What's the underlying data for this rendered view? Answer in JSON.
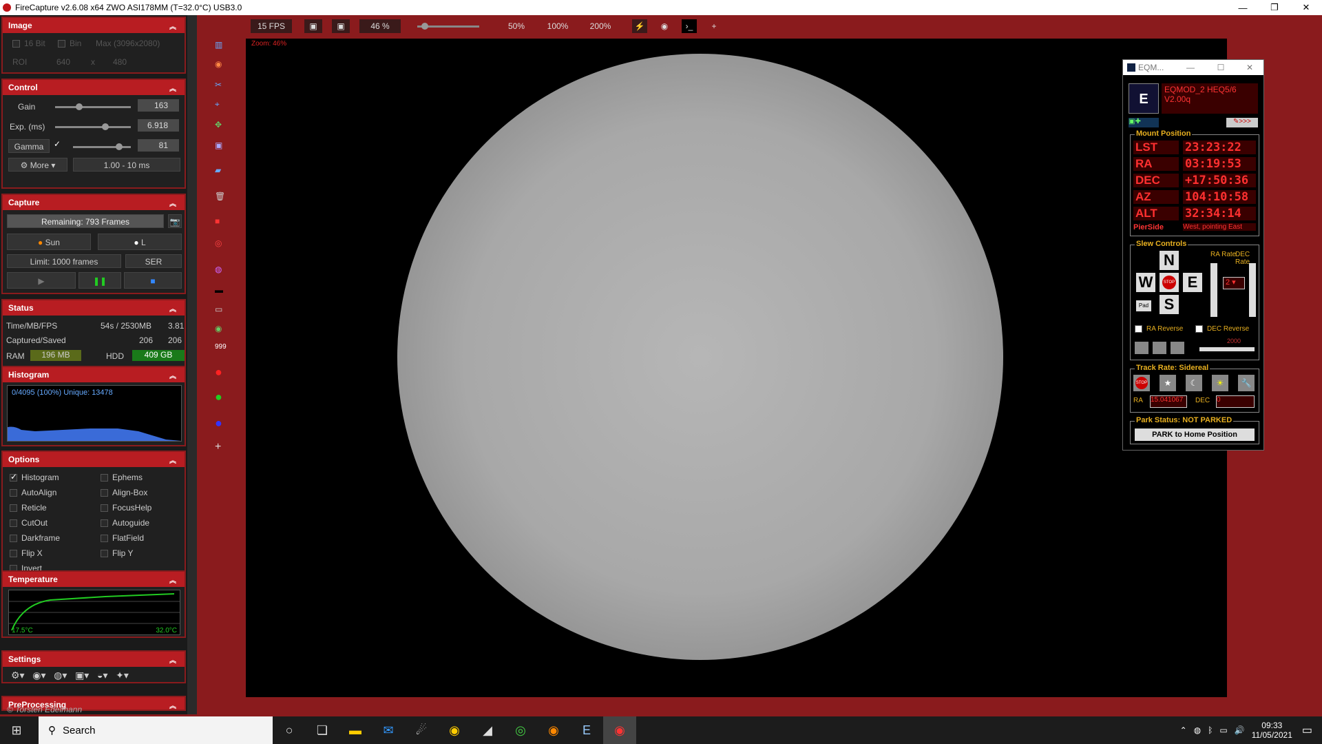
{
  "window": {
    "title": "FireCapture v2.6.08  x64    ZWO ASI178MM (T=32.0°C) USB3.0",
    "min": "—",
    "max": "❐",
    "close": "✕"
  },
  "image_panel": {
    "title": "Image",
    "bit16": "16 Bit",
    "bin": "Bin",
    "max": "Max (3096x2080)",
    "roi": "ROI",
    "w": "640",
    "x": "x",
    "h": "480"
  },
  "control": {
    "title": "Control",
    "gain_label": "Gain",
    "gain": "163",
    "exp_label": "Exp. (ms)",
    "exp": "6.918",
    "gamma_label": "Gamma",
    "gamma": "81",
    "more": "More",
    "range": "1.00 - 10 ms"
  },
  "capture": {
    "title": "Capture",
    "remaining": "Remaining: 793 Frames",
    "sun": "Sun",
    "l": "L",
    "limit": "Limit: 1000 frames",
    "format": "SER"
  },
  "status": {
    "title": "Status",
    "r1_label": "Time/MB/FPS",
    "r1_val": "54s / 2530MB",
    "r1_fps": "3.81",
    "r2_label": "Captured/Saved",
    "r2_cap": "206",
    "r2_saved": "206",
    "ram_label": "RAM",
    "ram": "196 MB",
    "hdd_label": "HDD",
    "hdd": "409 GB"
  },
  "histogram": {
    "title": "Histogram",
    "info": "0/4095 (100%)  Unique: 13478"
  },
  "options": {
    "title": "Options",
    "left": [
      {
        "label": "Histogram",
        "on": true
      },
      {
        "label": "AutoAlign",
        "on": false
      },
      {
        "label": "Reticle",
        "on": false
      },
      {
        "label": "CutOut",
        "on": false
      },
      {
        "label": "Darkframe",
        "on": false
      },
      {
        "label": "Flip X",
        "on": false
      },
      {
        "label": "Invert",
        "on": false
      }
    ],
    "right": [
      {
        "label": "Ephems"
      },
      {
        "label": "Align-Box"
      },
      {
        "label": "FocusHelp"
      },
      {
        "label": "Autoguide"
      },
      {
        "label": "FlatField"
      },
      {
        "label": "Flip Y"
      }
    ]
  },
  "temperature": {
    "title": "Temperature",
    "min": "17.5°C",
    "max": "32.0°C"
  },
  "settings": {
    "title": "Settings"
  },
  "preprocessing": {
    "title": "PreProcessing"
  },
  "copyright": "© Torsten Edelmann",
  "toolbar": {
    "fps": "15 FPS",
    "zoom": "46 %",
    "z50": "50%",
    "z100": "100%",
    "z200": "200%",
    "plus": "+"
  },
  "viewer": {
    "zoom_label": "Zoom: 46%"
  },
  "eqmod": {
    "title": "EQM...",
    "name": "EQMOD_2 HEQ5/6",
    "version": "V2.00q",
    "mount_position": "Mount Position",
    "lst_label": "LST",
    "lst": "23:23:22",
    "ra_label": "RA",
    "ra": "03:19:53",
    "dec_label": "DEC",
    "dec": "+17:50:36",
    "az_label": "AZ",
    "az": "104:10:58",
    "alt_label": "ALT",
    "alt": "32:34:14",
    "pierside_label": "PierSide",
    "pierside": "West, pointing East",
    "slew_controls": "Slew Controls",
    "ra_rate": "RA Rate",
    "dec_rate": "DEC Rate",
    "n": "N",
    "w": "W",
    "e": "E",
    "s": "S",
    "stop": "STOP",
    "pad": "Pad",
    "rate_val": "2",
    "ra_reverse": "RA Reverse",
    "dec_reverse": "DEC Reverse",
    "slider_val": "2000",
    "track_rate": "Track Rate: Sidereal",
    "track_ra_label": "RA",
    "track_ra": "15.041067",
    "track_dec_label": "DEC",
    "track_dec": "0",
    "park_status": "Park Status: NOT PARKED",
    "park_button": "PARK to Home Position"
  },
  "taskbar": {
    "search": "Search",
    "time": "09:33",
    "date": "11/05/2021"
  }
}
